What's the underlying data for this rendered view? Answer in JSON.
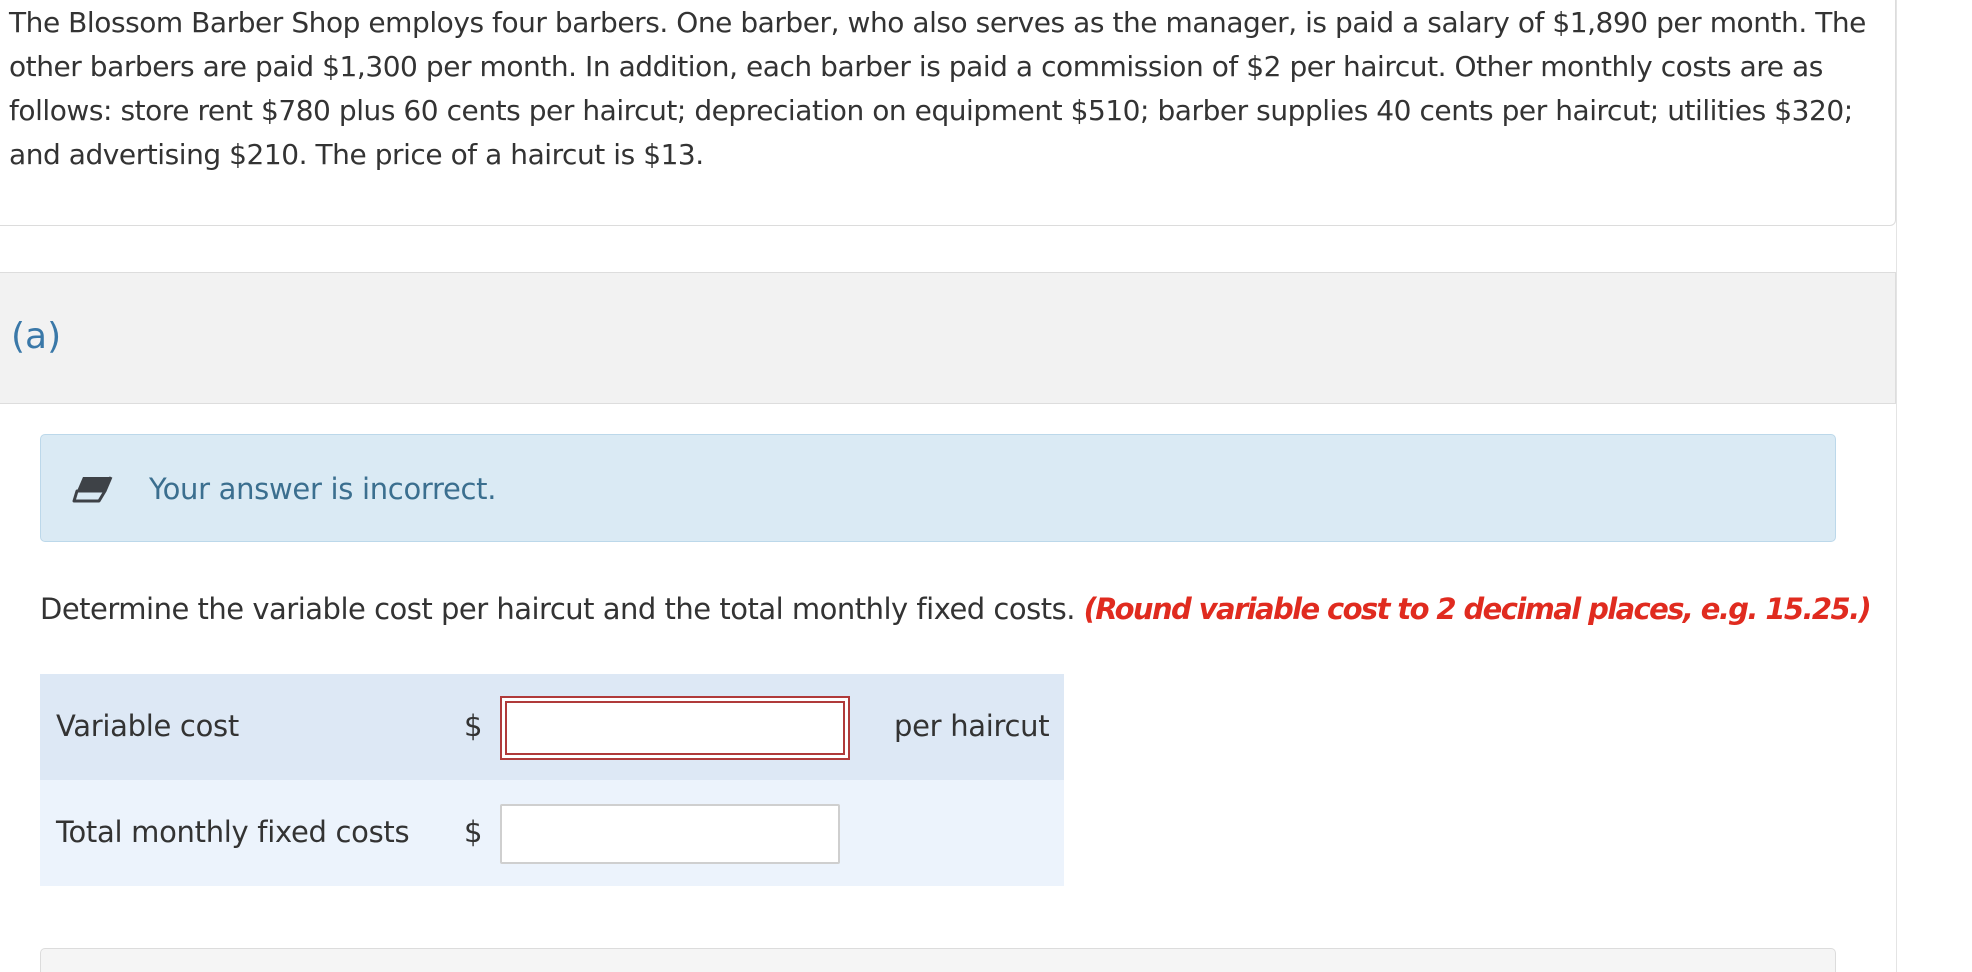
{
  "problem": {
    "text": "The Blossom Barber Shop employs four barbers. One barber, who also serves as the manager, is paid a salary of $1,890 per month. The other barbers are paid $1,300 per month. In addition, each barber is paid a commission of $2 per haircut. Other monthly costs are as follows: store rent $780 plus 60 cents per haircut; depreciation on equipment $510; barber supplies 40 cents per haircut; utilities $320; and advertising $210. The price of a haircut is $13."
  },
  "part": {
    "label": "(a)"
  },
  "feedback": {
    "icon": "eraser-icon",
    "message": "Your answer is incorrect.",
    "color": "#3b6f8f",
    "background": "#daeaf4"
  },
  "instructions": {
    "text": "Determine the variable cost per haircut and the total monthly fixed costs.",
    "hint": "(Round variable cost to 2 decimal places, e.g. 15.25.)",
    "hint_color": "#e02b1f"
  },
  "answers": [
    {
      "label": "Variable cost",
      "currency": "$",
      "value": "",
      "unit": "per haircut",
      "status": "incorrect"
    },
    {
      "label": "Total monthly fixed costs",
      "currency": "$",
      "value": "",
      "unit": "",
      "status": "unanswered"
    }
  ],
  "colors": {
    "part_label": "#3a78a8",
    "incorrect_border": "#b03a3a",
    "row_1_bg": "#dde8f5",
    "row_2_bg": "#ecf3fc"
  }
}
